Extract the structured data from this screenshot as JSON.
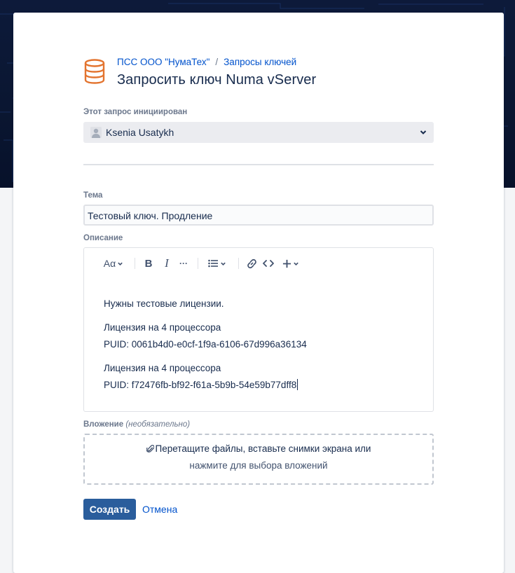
{
  "breadcrumb": {
    "project": "ПСС ООО \"НумаТех\"",
    "separator": "/",
    "queue": "Запросы ключей"
  },
  "title": "Запросить ключ Numa vServer",
  "icons": {
    "request_type": "database-icon",
    "dropdown": "chevron-down-icon",
    "attachment": "paperclip-icon"
  },
  "colors": {
    "accent": "#2a5d9c",
    "link": "#0052cc",
    "icon_orange": "#e3742f"
  },
  "reporter": {
    "label": "Этот запрос инициирован",
    "name": "Ksenia Usatykh"
  },
  "subject": {
    "label": "Тема",
    "value": "Тестовый ключ. Продление"
  },
  "description": {
    "label": "Описание",
    "toolbar": {
      "text_style": "Aα",
      "bold": "B",
      "italic": "I",
      "more": "···"
    },
    "lines": [
      "Нужны тестовые лицензии.",
      "Лицензия на 4 процессора",
      "PUID: 0061b4d0-e0cf-1f9a-6106-67d996a36134",
      "Лицензия на 4 процессора",
      "PUID: f72476fb-bf92-f61a-5b9b-54e59b77dff8"
    ]
  },
  "attachment": {
    "label": "Вложение",
    "optional": "(необязательно)",
    "line1": "Перетащите файлы, вставьте снимки экрана или",
    "line2": "нажмите для выбора вложений"
  },
  "actions": {
    "create": "Создать",
    "cancel": "Отмена"
  }
}
